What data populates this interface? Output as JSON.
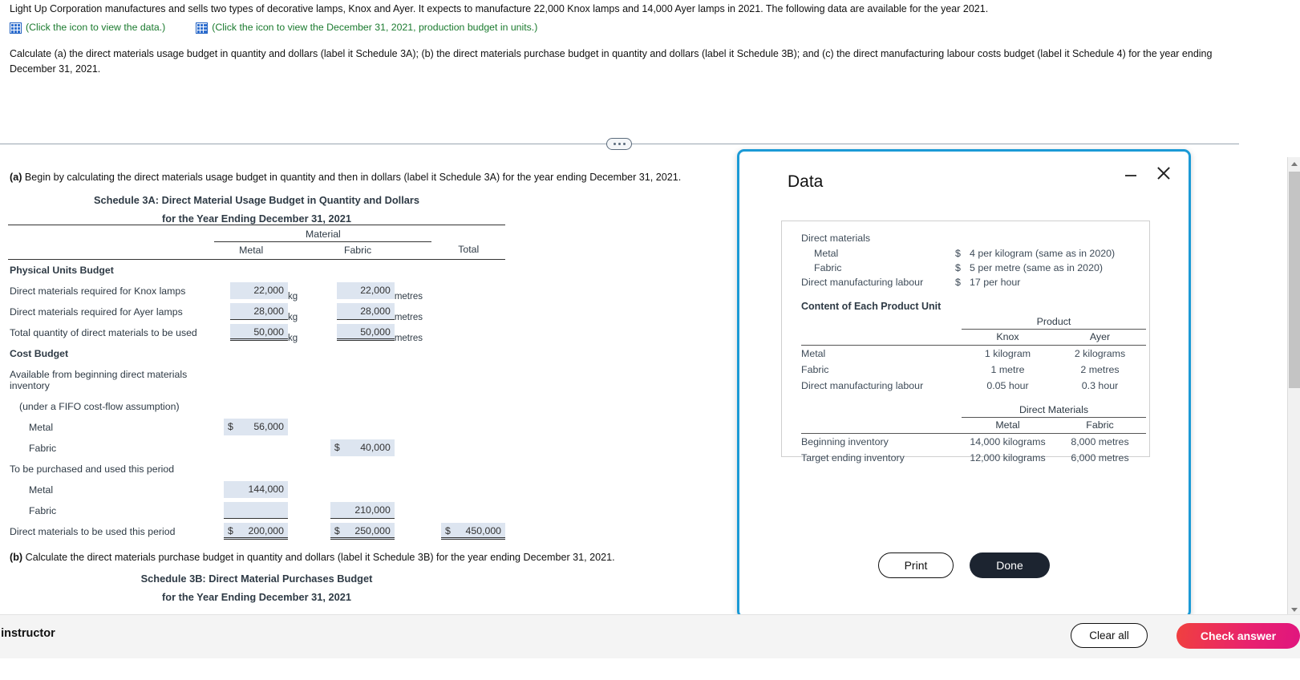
{
  "problem": {
    "statement": "Light Up Corporation manufactures and sells two types of decorative lamps, Knox and Ayer. It expects to manufacture 22,000 Knox lamps and 14,000 Ayer lamps in 2021. The following data are available for the year 2021.",
    "icon_links": [
      {
        "icon": "table-grid-icon",
        "text": "(Click the icon to view the data.)",
        "color": "#1a7a2e"
      },
      {
        "icon": "table-grid-icon",
        "text": "(Click the icon to view the December 31, 2021, production budget in units.)",
        "color": "#1a7a2e"
      }
    ],
    "instruction": "Calculate (a) the direct materials usage budget in quantity and dollars (label it Schedule 3A); (b) the direct materials purchase budget in quantity and dollars (label it Schedule 3B); and (c) the direct manufacturing labour costs budget (label it Schedule 4) for the year ending December 31, 2021."
  },
  "work": {
    "part_a_prefix": "(a)",
    "part_a_text": " Begin by calculating the direct materials usage budget in quantity and then in dollars (label it Schedule 3A) for the year ending December 31, 2021.",
    "schedule_3a": {
      "title": "Schedule 3A: Direct Material Usage Budget in Quantity and Dollars",
      "subtitle": "for the Year Ending December 31, 2021",
      "group_header": "Material",
      "columns": [
        "Metal",
        "Fabric",
        "Total"
      ],
      "sections": {
        "physical": "Physical Units Budget",
        "cost": "Cost Budget"
      },
      "rows": {
        "knox_label": "Direct materials required for Knox lamps",
        "knox_metal": "22,000",
        "knox_metal_unit": "kg",
        "knox_fabric": "22,000",
        "knox_fabric_unit": "metres",
        "ayer_label": "Direct materials required for Ayer lamps",
        "ayer_metal": "28,000",
        "ayer_metal_unit": "kg",
        "ayer_fabric": "28,000",
        "ayer_fabric_unit": "metres",
        "total_label": "Total quantity of direct materials to be used",
        "total_metal": "50,000",
        "total_metal_unit": "kg",
        "total_fabric": "50,000",
        "total_fabric_unit": "metres",
        "avail_label": "Available from beginning direct materials inventory",
        "fifo_label": "(under a FIFO cost-flow assumption)",
        "avail_metal_label": "Metal",
        "avail_metal_dollar": "$",
        "avail_metal_value": "56,000",
        "avail_fabric_label": "Fabric",
        "avail_fabric_dollar": "$",
        "avail_fabric_value": "40,000",
        "purchase_label": "To be purchased and used this period",
        "purchase_metal_label": "Metal",
        "purchase_metal_value": "144,000",
        "purchase_fabric_label": "Fabric",
        "purchase_fabric_value": "210,000",
        "dm_used_label": "Direct materials to be used this period",
        "dm_used_metal_dollar": "$",
        "dm_used_metal": "200,000",
        "dm_used_fabric_dollar": "$",
        "dm_used_fabric": "250,000",
        "dm_used_total_dollar": "$",
        "dm_used_total": "450,000"
      }
    },
    "part_b_prefix": "(b)",
    "part_b_text": " Calculate the direct materials purchase budget in quantity and dollars (label it Schedule 3B) for the year ending December 31, 2021.",
    "schedule_3b": {
      "title": "Schedule 3B: Direct Material Purchases Budget",
      "subtitle": "for the Year Ending December 31, 2021"
    }
  },
  "modal": {
    "title": "Data",
    "minimize_icon": "minimize-icon",
    "close_icon": "close-icon",
    "direct_materials_heading": "Direct materials",
    "rates": [
      {
        "name": "Metal",
        "dollar": "$",
        "value": "4 per kilogram (same as in 2020)"
      },
      {
        "name": "Fabric",
        "dollar": "$",
        "value": "5 per metre (same as in 2020)"
      }
    ],
    "labour_rate": {
      "name": "Direct manufacturing labour",
      "dollar": "$",
      "value": "17 per hour"
    },
    "content_section_title": "Content of Each Product Unit",
    "product_group": "Product",
    "product_columns": [
      "Knox",
      "Ayer"
    ],
    "product_rows": [
      {
        "label": "Metal",
        "knox": "1 kilogram",
        "ayer": "2 kilograms"
      },
      {
        "label": "Fabric",
        "knox": "1 metre",
        "ayer": "2 metres"
      },
      {
        "label": "Direct manufacturing labour",
        "knox": "0.05 hour",
        "ayer": "0.3 hour"
      }
    ],
    "materials_group": "Direct Materials",
    "materials_columns": [
      "Metal",
      "Fabric"
    ],
    "materials_rows": [
      {
        "label": "Beginning inventory",
        "metal": "14,000 kilograms",
        "fabric": "8,000 metres"
      },
      {
        "label": "Target ending inventory",
        "metal": "12,000 kilograms",
        "fabric": "6,000 metres"
      }
    ],
    "print_label": "Print",
    "done_label": "Done",
    "border_color": "#1b9ad6"
  },
  "bottom_bar": {
    "ask_label": "k my instructor",
    "clear_label": "Clear all",
    "check_label": "Check answer",
    "check_color": "#e8216f"
  },
  "scrollbar": {
    "up_icon": "scroll-up-arrow-icon",
    "down_icon": "scroll-down-arrow-icon"
  }
}
